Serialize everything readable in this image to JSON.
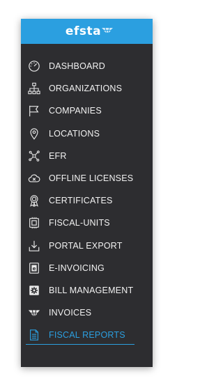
{
  "brand": {
    "name": "efsta",
    "color": "#2b9fe0"
  },
  "sidebar": {
    "background": "#2d2d30",
    "items": [
      {
        "label": "DASHBOARD",
        "icon": "dashboard-gauge-icon"
      },
      {
        "label": "ORGANIZATIONS",
        "icon": "org-chart-icon"
      },
      {
        "label": "COMPANIES",
        "icon": "flag-icon"
      },
      {
        "label": "LOCATIONS",
        "icon": "location-pin-icon"
      },
      {
        "label": "EFR",
        "icon": "network-nodes-icon"
      },
      {
        "label": "OFFLINE LICENSES",
        "icon": "cloud-cross-icon"
      },
      {
        "label": "CERTIFICATES",
        "icon": "award-ribbon-icon"
      },
      {
        "label": "FISCAL-UNITS",
        "icon": "chip-icon"
      },
      {
        "label": "PORTAL EXPORT",
        "icon": "download-icon"
      },
      {
        "label": "E-INVOICING",
        "icon": "e-document-icon"
      },
      {
        "label": "BILL MANAGEMENT",
        "icon": "gear-document-icon"
      },
      {
        "label": "INVOICES",
        "icon": "efsta-wing-icon"
      },
      {
        "label": "FISCAL REPORTS",
        "icon": "report-document-icon",
        "active": true
      }
    ]
  }
}
